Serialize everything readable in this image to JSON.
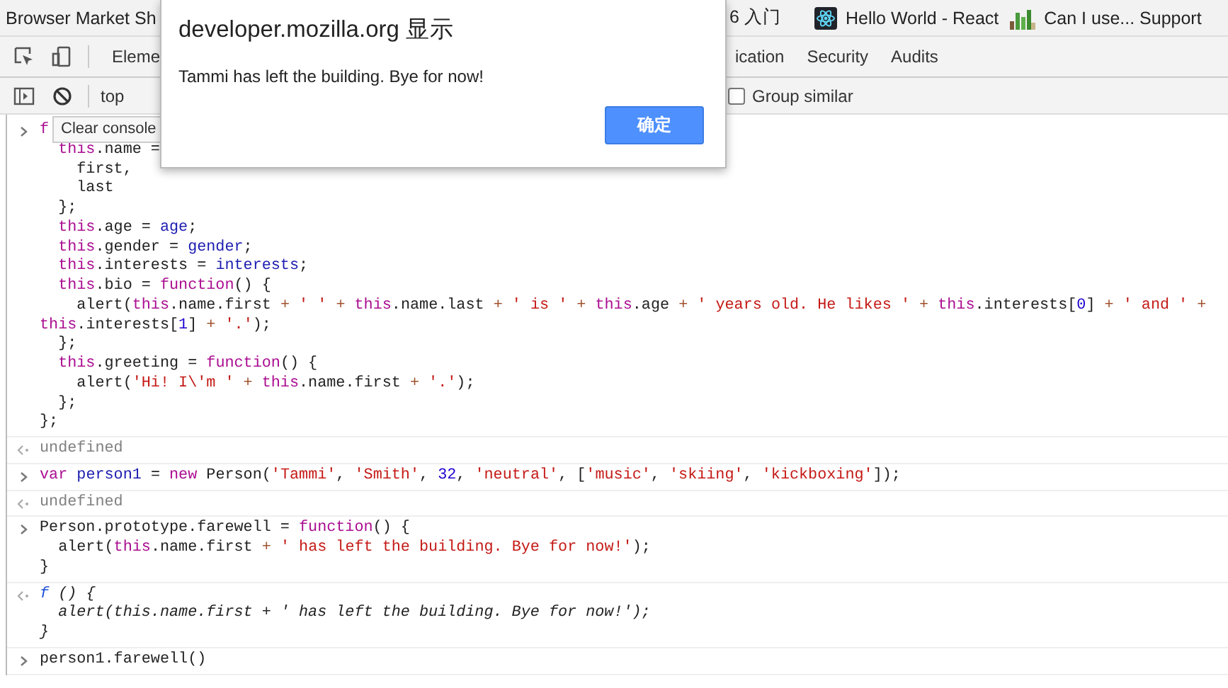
{
  "bookmarks": [
    {
      "label": "Browser Market Sh"
    },
    {
      "label": "6 入门"
    },
    {
      "label": "Hello World - React"
    },
    {
      "label": "Can I use... Support"
    }
  ],
  "devtools_tabs": [
    {
      "label": "Eleme",
      "selected": false
    },
    {
      "label": "ication",
      "selected": false
    },
    {
      "label": "Security",
      "selected": false
    },
    {
      "label": "Audits",
      "selected": false
    }
  ],
  "toolbar": {
    "context": "top",
    "group_similar": {
      "label": "Group similar",
      "checked": false
    }
  },
  "tooltip": "Clear console",
  "dialog": {
    "title": "developer.mozilla.org 显示",
    "message": "Tammi has left the building. Bye for now!",
    "button": "确定"
  },
  "console": [
    {
      "kind": "input",
      "lines": [
        [
          {
            "kind": "kw",
            "text": "f"
          }
        ],
        [
          {
            "kind": "kw",
            "text": "  this"
          },
          {
            "kind": "plain",
            "text": ".name ="
          }
        ],
        [
          {
            "kind": "plain",
            "text": "    first,"
          }
        ],
        [
          {
            "kind": "plain",
            "text": "    last"
          }
        ],
        [
          {
            "kind": "plain",
            "text": "  };"
          }
        ],
        [
          {
            "kind": "kw",
            "text": "  this"
          },
          {
            "kind": "plain",
            "text": ".age = "
          },
          {
            "kind": "var",
            "text": "age"
          },
          {
            "kind": "plain",
            "text": ";"
          }
        ],
        [
          {
            "kind": "kw",
            "text": "  this"
          },
          {
            "kind": "plain",
            "text": ".gender = "
          },
          {
            "kind": "var",
            "text": "gender"
          },
          {
            "kind": "plain",
            "text": ";"
          }
        ],
        [
          {
            "kind": "kw",
            "text": "  this"
          },
          {
            "kind": "plain",
            "text": ".interests = "
          },
          {
            "kind": "var",
            "text": "interests"
          },
          {
            "kind": "plain",
            "text": ";"
          }
        ],
        [
          {
            "kind": "kw",
            "text": "  this"
          },
          {
            "kind": "plain",
            "text": ".bio = "
          },
          {
            "kind": "kw",
            "text": "function"
          },
          {
            "kind": "plain",
            "text": "() {"
          }
        ],
        [
          {
            "kind": "plain",
            "text": "    alert("
          },
          {
            "kind": "kw",
            "text": "this"
          },
          {
            "kind": "plain",
            "text": ".name.first "
          },
          {
            "kind": "op",
            "text": "+"
          },
          {
            "kind": "str",
            "text": " ' ' "
          },
          {
            "kind": "op",
            "text": "+ "
          },
          {
            "kind": "kw",
            "text": "this"
          },
          {
            "kind": "plain",
            "text": ".name.last "
          },
          {
            "kind": "op",
            "text": "+"
          },
          {
            "kind": "str",
            "text": " ' is ' "
          },
          {
            "kind": "op",
            "text": "+ "
          },
          {
            "kind": "kw",
            "text": "this"
          },
          {
            "kind": "plain",
            "text": ".age "
          },
          {
            "kind": "op",
            "text": "+"
          },
          {
            "kind": "str",
            "text": " ' years old. He likes ' "
          },
          {
            "kind": "op",
            "text": "+ "
          },
          {
            "kind": "kw",
            "text": "this"
          },
          {
            "kind": "plain",
            "text": ".interests["
          },
          {
            "kind": "num",
            "text": "0"
          },
          {
            "kind": "plain",
            "text": "] "
          },
          {
            "kind": "op",
            "text": "+"
          },
          {
            "kind": "str",
            "text": " ' and ' "
          },
          {
            "kind": "op",
            "text": "+"
          }
        ],
        [
          {
            "kind": "kw",
            "text": "this"
          },
          {
            "kind": "plain",
            "text": ".interests["
          },
          {
            "kind": "num",
            "text": "1"
          },
          {
            "kind": "plain",
            "text": "] "
          },
          {
            "kind": "op",
            "text": "+"
          },
          {
            "kind": "str",
            "text": " '.'"
          },
          {
            "kind": "plain",
            "text": ");"
          }
        ],
        [
          {
            "kind": "plain",
            "text": "  };"
          }
        ],
        [
          {
            "kind": "kw",
            "text": "  this"
          },
          {
            "kind": "plain",
            "text": ".greeting = "
          },
          {
            "kind": "kw",
            "text": "function"
          },
          {
            "kind": "plain",
            "text": "() {"
          }
        ],
        [
          {
            "kind": "plain",
            "text": "    alert("
          },
          {
            "kind": "str",
            "text": "'Hi! I\\'m '"
          },
          {
            "kind": "op",
            "text": " + "
          },
          {
            "kind": "kw",
            "text": "this"
          },
          {
            "kind": "plain",
            "text": ".name.first "
          },
          {
            "kind": "op",
            "text": "+"
          },
          {
            "kind": "str",
            "text": " '.'"
          },
          {
            "kind": "plain",
            "text": ");"
          }
        ],
        [
          {
            "kind": "plain",
            "text": "  };"
          }
        ],
        [
          {
            "kind": "plain",
            "text": "};"
          }
        ]
      ]
    },
    {
      "kind": "output",
      "lines": [
        [
          {
            "kind": "undef",
            "text": "undefined"
          }
        ]
      ]
    },
    {
      "kind": "input",
      "lines": [
        [
          {
            "kind": "kw",
            "text": "var "
          },
          {
            "kind": "var",
            "text": "person1"
          },
          {
            "kind": "plain",
            "text": " = "
          },
          {
            "kind": "kw",
            "text": "new"
          },
          {
            "kind": "plain",
            "text": " Person("
          },
          {
            "kind": "str",
            "text": "'Tammi'"
          },
          {
            "kind": "plain",
            "text": ", "
          },
          {
            "kind": "str",
            "text": "'Smith'"
          },
          {
            "kind": "plain",
            "text": ", "
          },
          {
            "kind": "num",
            "text": "32"
          },
          {
            "kind": "plain",
            "text": ", "
          },
          {
            "kind": "str",
            "text": "'neutral'"
          },
          {
            "kind": "plain",
            "text": ", ["
          },
          {
            "kind": "str",
            "text": "'music'"
          },
          {
            "kind": "plain",
            "text": ", "
          },
          {
            "kind": "str",
            "text": "'skiing'"
          },
          {
            "kind": "plain",
            "text": ", "
          },
          {
            "kind": "str",
            "text": "'kickboxing'"
          },
          {
            "kind": "plain",
            "text": "]);"
          }
        ]
      ]
    },
    {
      "kind": "output",
      "lines": [
        [
          {
            "kind": "undef",
            "text": "undefined"
          }
        ]
      ]
    },
    {
      "kind": "input",
      "lines": [
        [
          {
            "kind": "plain",
            "text": "Person.prototype.farewell = "
          },
          {
            "kind": "kw",
            "text": "function"
          },
          {
            "kind": "plain",
            "text": "() {"
          }
        ],
        [
          {
            "kind": "plain",
            "text": "  alert("
          },
          {
            "kind": "kw",
            "text": "this"
          },
          {
            "kind": "plain",
            "text": ".name.first "
          },
          {
            "kind": "op",
            "text": "+"
          },
          {
            "kind": "str",
            "text": " ' has left the building. Bye for now!'"
          },
          {
            "kind": "plain",
            "text": ");"
          }
        ],
        [
          {
            "kind": "plain",
            "text": "}"
          }
        ]
      ]
    },
    {
      "kind": "function_output",
      "lines": [
        [
          {
            "kind": "fn",
            "text": "f"
          },
          {
            "kind": "plain",
            "text": " () {"
          }
        ],
        [
          {
            "kind": "plain",
            "text": "  alert(this.name.first + ' has left the building. Bye for now!');"
          }
        ],
        [
          {
            "kind": "plain",
            "text": "}"
          }
        ]
      ]
    },
    {
      "kind": "input",
      "lines": [
        [
          {
            "kind": "plain",
            "text": "person1.farewell()"
          }
        ]
      ]
    }
  ]
}
